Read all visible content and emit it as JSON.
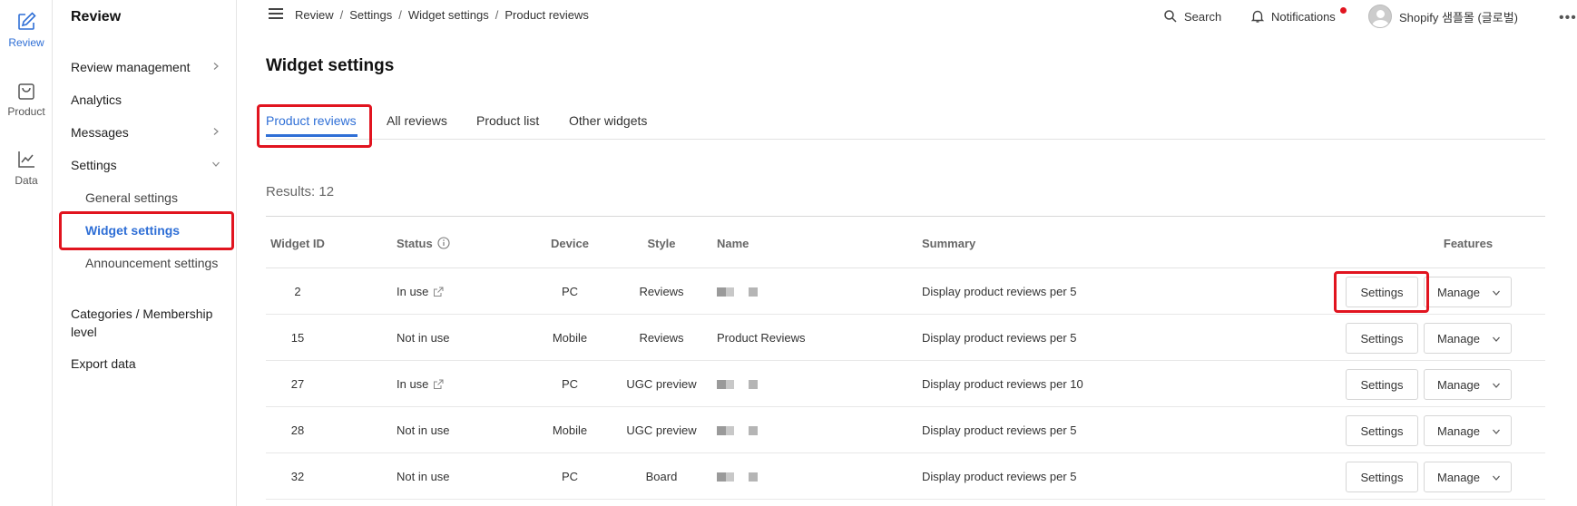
{
  "rail": {
    "items": [
      {
        "label": "Review",
        "icon": "pencil-square-icon",
        "active": true
      },
      {
        "label": "Product",
        "icon": "shopping-bag-icon"
      },
      {
        "label": "Data",
        "icon": "line-chart-icon"
      }
    ]
  },
  "sidebar": {
    "title": "Review",
    "items": {
      "review_management": "Review management",
      "analytics": "Analytics",
      "messages": "Messages",
      "settings": "Settings",
      "general_settings": "General settings",
      "widget_settings": "Widget settings",
      "announcement_settings": "Announcement settings",
      "categories": "Categories / Membership level",
      "export": "Export data"
    }
  },
  "topbar": {
    "breadcrumbs": [
      "Review",
      "Settings",
      "Widget settings",
      "Product reviews"
    ],
    "separator": "/",
    "search_label": "Search",
    "notifications_label": "Notifications",
    "account_name": "Shopify 샘플몰 (글로벌)",
    "more_label": "•••"
  },
  "main": {
    "title": "Widget settings",
    "tabs": [
      "Product reviews",
      "All reviews",
      "Product list",
      "Other widgets"
    ],
    "active_tab": 0,
    "results_label": "Results: 12",
    "table": {
      "headers": {
        "widget_id": "Widget ID",
        "status": "Status",
        "device": "Device",
        "style": "Style",
        "name": "Name",
        "summary": "Summary",
        "features": "Features"
      },
      "settings_label": "Settings",
      "manage_label": "Manage",
      "rows": [
        {
          "id": "2",
          "status": "In use",
          "external_link": true,
          "device": "PC",
          "style": "Reviews",
          "name": "",
          "name_redacted": true,
          "summary": "Display product reviews per 5"
        },
        {
          "id": "15",
          "status": "Not in use",
          "external_link": false,
          "device": "Mobile",
          "style": "Reviews",
          "name": "Product Reviews",
          "name_redacted": false,
          "summary": "Display product reviews per 5"
        },
        {
          "id": "27",
          "status": "In use",
          "external_link": true,
          "device": "PC",
          "style": "UGC preview",
          "name": "",
          "name_redacted": true,
          "summary": "Display product reviews per 10"
        },
        {
          "id": "28",
          "status": "Not in use",
          "external_link": false,
          "device": "Mobile",
          "style": "UGC preview",
          "name": "",
          "name_redacted": true,
          "summary": "Display product reviews per 5"
        },
        {
          "id": "32",
          "status": "Not in use",
          "external_link": false,
          "device": "PC",
          "style": "Board",
          "name": "",
          "name_redacted": true,
          "summary": "Display product reviews per 5"
        }
      ]
    }
  },
  "colors": {
    "accent": "#2f6fd6",
    "highlight": "#e1141f",
    "notification_dot": "#e1141f"
  }
}
